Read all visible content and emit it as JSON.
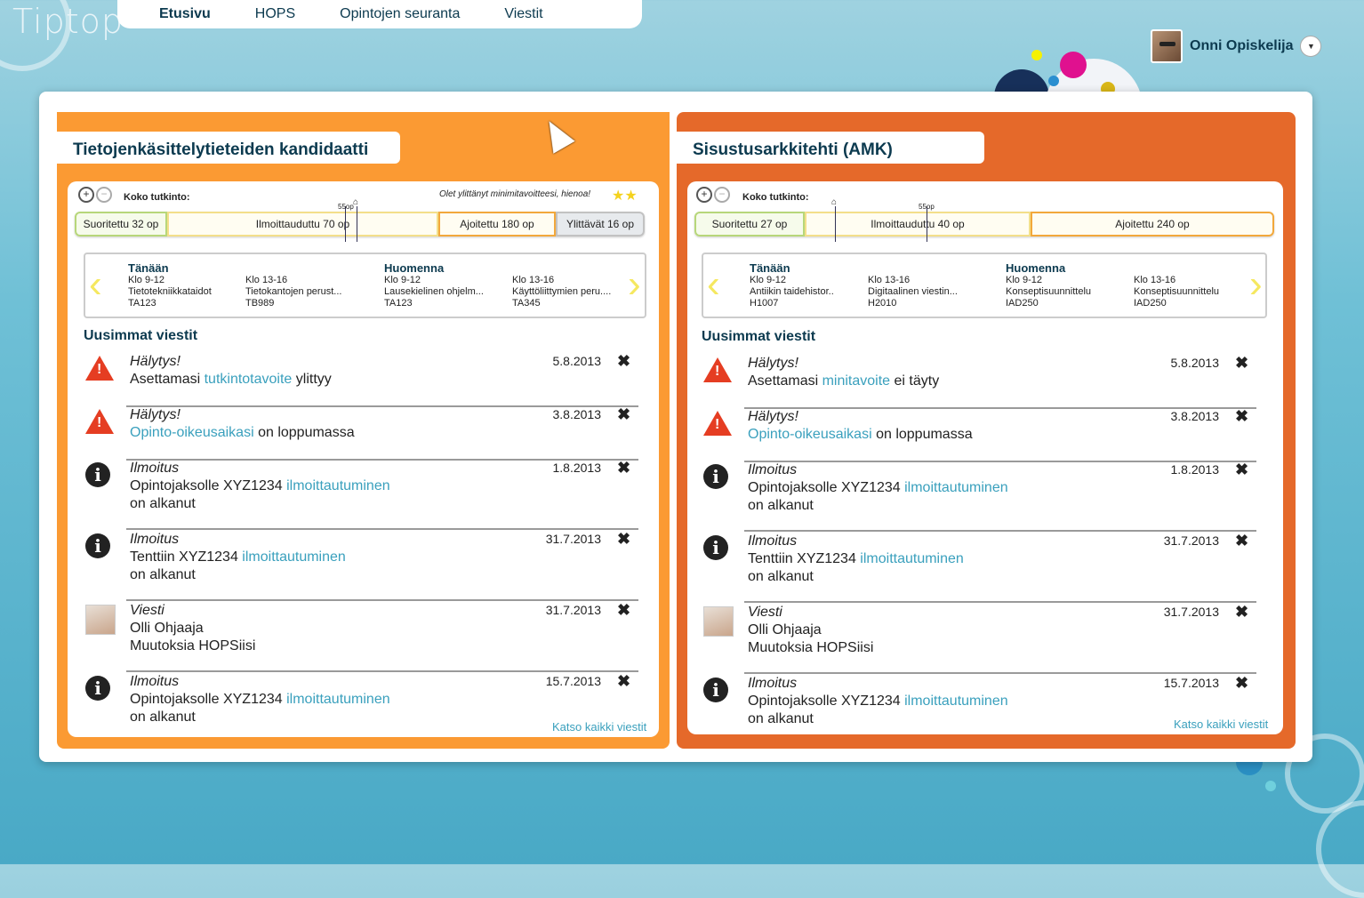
{
  "app": {
    "logo": "Tiptop"
  },
  "nav": {
    "items": [
      "Etusivu",
      "HOPS",
      "Opintojen seuranta",
      "Viestit"
    ]
  },
  "user": {
    "name": "Onni Opiskelija"
  },
  "left": {
    "title": "Tietojenkäsittelytieteiden kandidaatti",
    "koko": "Koko tutkinto:",
    "note": "Olet ylittänyt minimitavoitteesi, hienoa!",
    "bar": {
      "segments": [
        "Suoritettu 32 op",
        "Ilmoittauduttu 70 op",
        "Ajoitettu 180 op",
        "Ylittävät 16 op"
      ],
      "marker_label": "55op"
    },
    "schedule": {
      "today": "Tänään",
      "tomorrow": "Huomenna",
      "slots": [
        {
          "time": "Klo 9-12",
          "course": "Tietotekniikkataidot",
          "code": "TA123"
        },
        {
          "time": "Klo 13-16",
          "course": "Tietokantojen perust...",
          "code": "TB989"
        },
        {
          "time": "Klo 9-12",
          "course": "Lausekielinen ohjelm...",
          "code": "TA123"
        },
        {
          "time": "Klo 13-16",
          "course": "Käyttöliittymien peru....",
          "code": "TA345"
        }
      ]
    },
    "messages_title": "Uusimmat viestit",
    "messages": [
      {
        "type": "Hälytys!",
        "date": "5.8.2013",
        "l1a": "Asettamasi ",
        "l1b": "tutkintotavoite",
        "l1c": " ylittyy",
        "l2": ""
      },
      {
        "type": "Hälytys!",
        "date": "3.8.2013",
        "l1a": "",
        "l1b": "Opinto-oikeusaikasi",
        "l1c": " on loppumassa",
        "l2": ""
      },
      {
        "type": "Ilmoitus",
        "date": "1.8.2013",
        "l1a": "Opintojaksolle XYZ1234 ",
        "l1b": "ilmoittautuminen",
        "l1c": "",
        "l2": "on alkanut"
      },
      {
        "type": "Ilmoitus",
        "date": "31.7.2013",
        "l1a": "Tenttiin XYZ1234 ",
        "l1b": "ilmoittautuminen",
        "l1c": "",
        "l2": "on alkanut"
      },
      {
        "type": "Viesti",
        "date": "31.7.2013",
        "l1a": "Olli Ohjaaja",
        "l1b": "",
        "l1c": "",
        "l2": "Muutoksia HOPSiisi"
      },
      {
        "type": "Ilmoitus",
        "date": "15.7.2013",
        "l1a": "Opintojaksolle XYZ1234 ",
        "l1b": "ilmoittautuminen",
        "l1c": "",
        "l2": "on alkanut"
      }
    ],
    "see_all": "Katso kaikki viestit"
  },
  "right": {
    "title": "Sisustusarkkitehti (AMK)",
    "koko": "Koko tutkinto:",
    "bar": {
      "segments": [
        "Suoritettu 27 op",
        "Ilmoittauduttu 40 op",
        "Ajoitettu 240 op"
      ],
      "marker_label": "55op"
    },
    "schedule": {
      "today": "Tänään",
      "tomorrow": "Huomenna",
      "slots": [
        {
          "time": "Klo 9-12",
          "course": "Antiikin taidehistor..",
          "code": "H1007"
        },
        {
          "time": "Klo 13-16",
          "course": "Digitaalinen viestin...",
          "code": "H2010"
        },
        {
          "time": "Klo 9-12",
          "course": "Konseptisuunnittelu",
          "code": "IAD250"
        },
        {
          "time": "Klo 13-16",
          "course": "Konseptisuunnittelu",
          "code": "IAD250"
        }
      ]
    },
    "messages_title": "Uusimmat viestit",
    "messages": [
      {
        "type": "Hälytys!",
        "date": "5.8.2013",
        "l1a": "Asettamasi ",
        "l1b": "minitavoite",
        "l1c": " ei täyty",
        "l2": ""
      },
      {
        "type": "Hälytys!",
        "date": "3.8.2013",
        "l1a": "",
        "l1b": "Opinto-oikeusaikasi",
        "l1c": " on loppumassa",
        "l2": ""
      },
      {
        "type": "Ilmoitus",
        "date": "1.8.2013",
        "l1a": "Opintojaksolle XYZ1234 ",
        "l1b": "ilmoittautuminen",
        "l1c": "",
        "l2": "on alkanut"
      },
      {
        "type": "Ilmoitus",
        "date": "31.7.2013",
        "l1a": "Tenttiin XYZ1234 ",
        "l1b": "ilmoittautuminen",
        "l1c": "",
        "l2": "on alkanut"
      },
      {
        "type": "Viesti",
        "date": "31.7.2013",
        "l1a": "Olli Ohjaaja",
        "l1b": "",
        "l1c": "",
        "l2": "Muutoksia HOPSiisi"
      },
      {
        "type": "Ilmoitus",
        "date": "15.7.2013",
        "l1a": "Opintojaksolle XYZ1234 ",
        "l1b": "ilmoittautuminen",
        "l1c": "",
        "l2": "on alkanut"
      }
    ],
    "see_all": "Katso kaikki viestit"
  },
  "colors": {
    "left_card": "#fb9a33",
    "right_card": "#e5692a",
    "link": "#3aa0bd",
    "warning": "#e53d22"
  }
}
